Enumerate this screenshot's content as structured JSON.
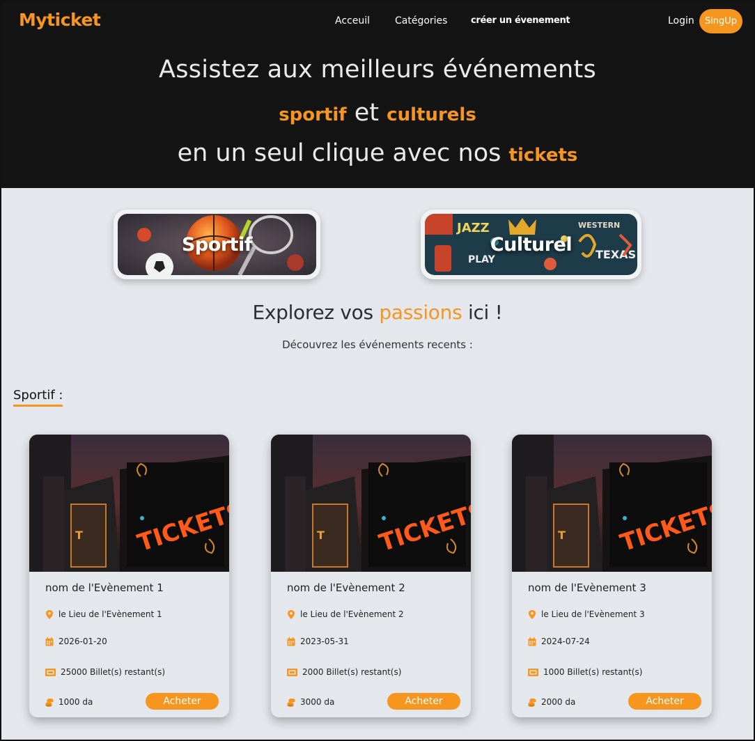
{
  "brand": {
    "logo": "Myticket",
    "accent": "#f7961e"
  },
  "nav": {
    "links": [
      "Acceuil",
      "Catégories",
      "créer un évenement"
    ],
    "login": "Login",
    "signup": "SingUp"
  },
  "hero": {
    "line1": "Assistez aux meilleurs événements",
    "line2_hl1": "sportif",
    "line2_mid": "et",
    "line2_hl2": "culturels",
    "line3_text": "en un seul clique avec nos",
    "line3_hl": "tickets"
  },
  "categories": [
    {
      "label": "Sportif"
    },
    {
      "label": "Culturel"
    }
  ],
  "explore": {
    "prefix": "Explorez vos",
    "highlight": "passions",
    "suffix": "ici !",
    "subtitle": "Découvrez les événements recents :"
  },
  "section": {
    "label": "Sportif :"
  },
  "events": [
    {
      "name": "nom de l'Evènement 1",
      "location": "le Lieu de l'Evènement 1",
      "date": "2026-01-20",
      "tickets": "25000 Billet(s) restant(s)",
      "price": "1000 da",
      "buy": "Acheter",
      "image_text": "TICKETS"
    },
    {
      "name": "nom de l'Evènement 2",
      "location": "le Lieu de l'Evènement 2",
      "date": "2023-05-31",
      "tickets": "2000 Billet(s) restant(s)",
      "price": "3000 da",
      "buy": "Acheter",
      "image_text": "TICKETS"
    },
    {
      "name": "nom de l'Evènement 3",
      "location": "le Lieu de l'Evènement 3",
      "date": "2024-07-24",
      "tickets": "1000 Billet(s) restant(s)",
      "price": "2000 da",
      "buy": "Acheter",
      "image_text": "TICKETS"
    }
  ],
  "icons": {
    "location": "map-pin-icon",
    "date": "calendar-icon",
    "tickets": "ticket-icon",
    "price": "coins-icon"
  }
}
